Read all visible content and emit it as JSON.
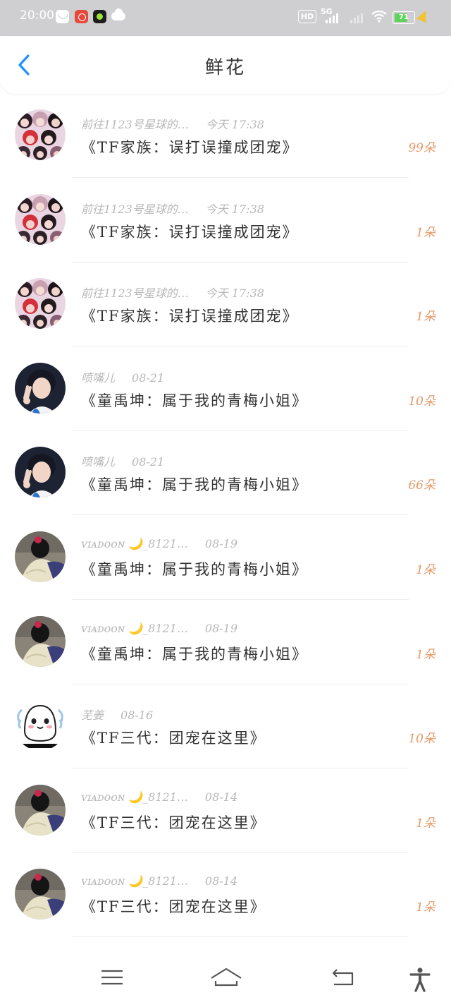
{
  "status_bar": {
    "time": "20:00",
    "hd_label": "HD",
    "network_label": "5G",
    "battery_level": 71,
    "battery_text": "71"
  },
  "header": {
    "title": "鲜花",
    "back_icon": "chevron-left-icon",
    "accent_color": "#1e90ff"
  },
  "items": [
    {
      "name": "前往1123号星球的…",
      "time": "今天 17:38",
      "title": "《TF家族：误打误撞成团宠》",
      "count": "99朵",
      "avatar": "group-girls"
    },
    {
      "name": "前往1123号星球的…",
      "time": "今天 17:38",
      "title": "《TF家族：误打误撞成团宠》",
      "count": "1朵",
      "avatar": "group-girls"
    },
    {
      "name": "前往1123号星球的…",
      "time": "今天 17:38",
      "title": "《TF家族：误打误撞成团宠》",
      "count": "1朵",
      "avatar": "group-girls"
    },
    {
      "name": "喷嘴儿",
      "time": "08-21",
      "title": "《童禹坤：属于我的青梅小姐》",
      "count": "10朵",
      "avatar": "boy-peace"
    },
    {
      "name": "喷嘴儿",
      "time": "08-21",
      "title": "《童禹坤：属于我的青梅小姐》",
      "count": "66朵",
      "avatar": "boy-peace"
    },
    {
      "name": "ᴠɪᴀᴅᴏᴏɴ 🌙_8121…",
      "time": "08-19",
      "title": "《童禹坤：属于我的青梅小姐》",
      "count": "1朵",
      "avatar": "dark-figure"
    },
    {
      "name": "ᴠɪᴀᴅᴏᴏɴ 🌙_8121…",
      "time": "08-19",
      "title": "《童禹坤：属于我的青梅小姐》",
      "count": "1朵",
      "avatar": "dark-figure"
    },
    {
      "name": "芜姜",
      "time": "08-16",
      "title": "《TF三代：团宠在这里》",
      "count": "10朵",
      "avatar": "ghost-sticker"
    },
    {
      "name": "ᴠɪᴀᴅᴏᴏɴ 🌙_8121…",
      "time": "08-14",
      "title": "《TF三代：团宠在这里》",
      "count": "1朵",
      "avatar": "dark-figure"
    },
    {
      "name": "ᴠɪᴀᴅᴏᴏɴ 🌙_8121…",
      "time": "08-14",
      "title": "《TF三代：团宠在这里》",
      "count": "1朵",
      "avatar": "dark-figure"
    }
  ],
  "nav": {
    "menu_icon": "menu-icon",
    "home_icon": "home-icon",
    "back_icon": "return-icon",
    "accessibility_icon": "accessibility-icon"
  },
  "colors": {
    "count": "#e39a6a",
    "meta": "#b8b8b8",
    "title": "#333333",
    "status_bar": "#cfcfd1"
  }
}
